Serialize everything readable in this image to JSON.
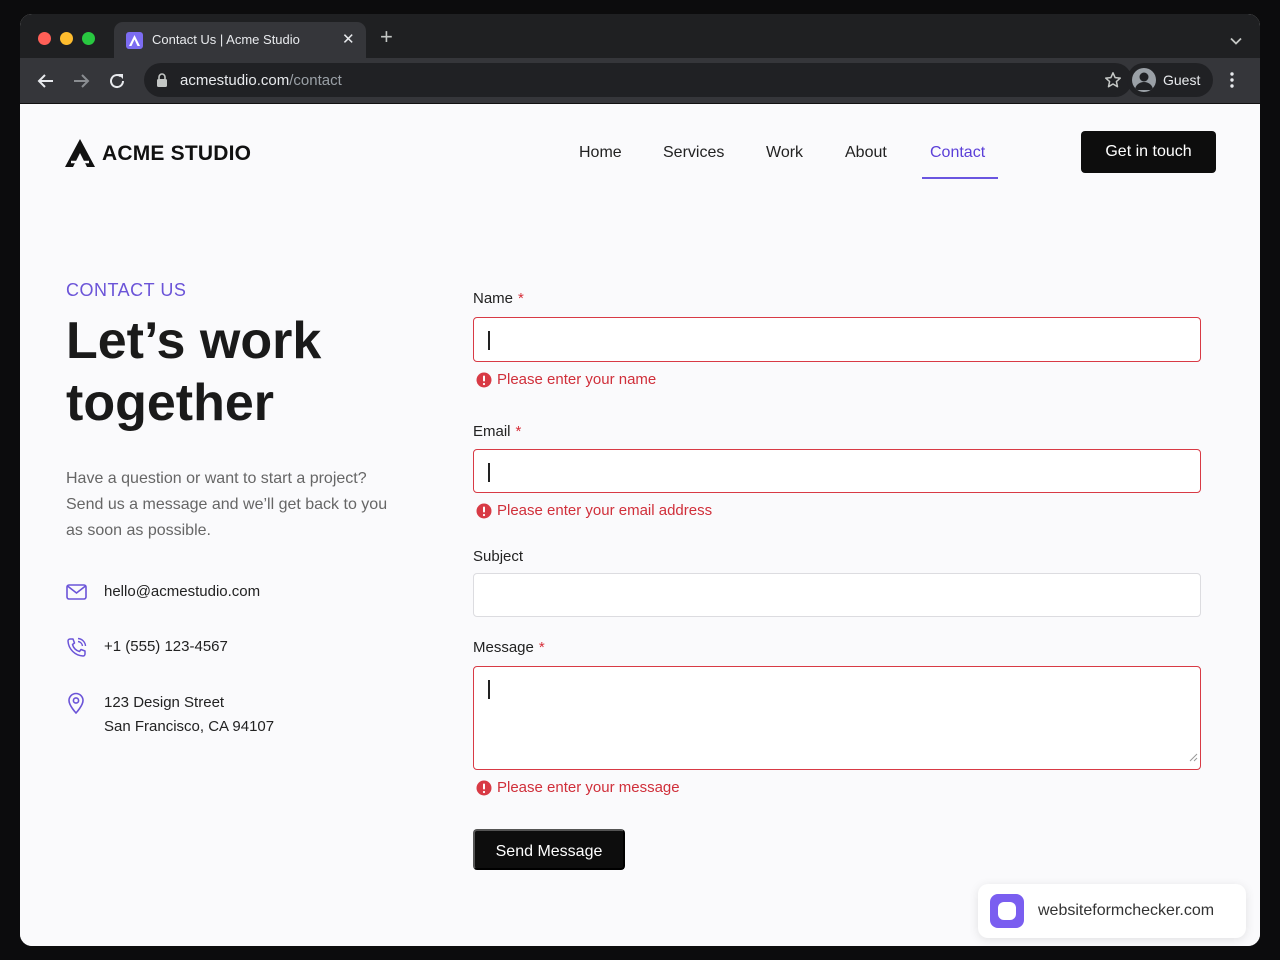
{
  "browser": {
    "tab_title": "Contact Us | Acme Studio",
    "url_domain": "acmestudio.com",
    "url_path": "/contact",
    "profile_label": "Guest"
  },
  "site": {
    "logo_text": "ACME STUDIO",
    "nav": [
      {
        "label": "Home",
        "active": false
      },
      {
        "label": "Services",
        "active": false
      },
      {
        "label": "Work",
        "active": false
      },
      {
        "label": "About",
        "active": false
      },
      {
        "label": "Contact",
        "active": true
      }
    ],
    "cta_label": "Get in touch"
  },
  "intro": {
    "eyebrow": "CONTACT US",
    "headline": "Let’s work together",
    "lede": "Have a question or want to start a project? Send us a message and we’ll get back to you as soon as possible."
  },
  "contact": {
    "email": "hello@acmestudio.com",
    "phone": "+1 (555) 123-4567",
    "address_line1": "123 Design Street",
    "address_line2": "San Francisco, CA 94107"
  },
  "form": {
    "required_mark": "*",
    "name": {
      "label": "Name",
      "value": "",
      "error": "Please enter your name"
    },
    "email": {
      "label": "Email",
      "value": "",
      "error": "Please enter your email address"
    },
    "subject": {
      "label": "Subject",
      "value": ""
    },
    "message": {
      "label": "Message",
      "value": "",
      "error": "Please enter your message"
    },
    "submit_label": "Send Message"
  },
  "badge": {
    "text": "websiteformchecker.com"
  },
  "colors": {
    "accent": "#5b3fd8",
    "error": "#d83a45",
    "primary_button": "#0d0d0d"
  }
}
